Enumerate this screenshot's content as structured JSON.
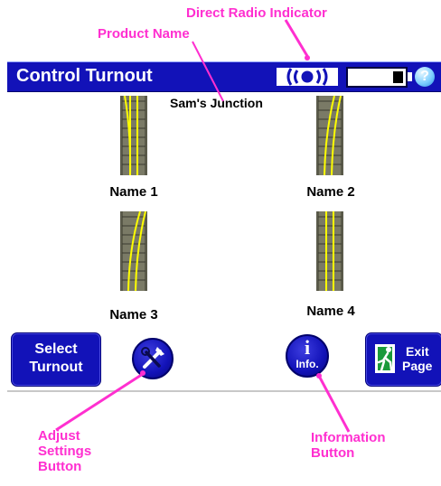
{
  "callouts": {
    "direct_radio_indicator": "Direct Radio Indicator",
    "product_name": "Product Name",
    "adjust_settings": [
      "Adjust",
      "Settings",
      "Button"
    ],
    "information": [
      "Information",
      "Button"
    ]
  },
  "header": {
    "title": "Control Turnout",
    "help_symbol": "?"
  },
  "product_name": "Sam's Junction",
  "turnouts": [
    {
      "name": "Name 1",
      "direction": "left"
    },
    {
      "name": "Name 2",
      "direction": "right"
    },
    {
      "name": "Name 3",
      "direction": "right"
    },
    {
      "name": "Name 4",
      "direction": "straight"
    }
  ],
  "buttons": {
    "select_turnout": [
      "Select",
      "Turnout"
    ],
    "info_label": "Info.",
    "exit_page": [
      "Exit",
      "Page"
    ]
  },
  "colors": {
    "accent_blue": "#1212b8",
    "callout_magenta": "#ff2fd0",
    "track_rail": "#ffff00"
  },
  "icons": {
    "radio": "radio-signal-icon",
    "battery": "battery-icon",
    "help": "help-icon",
    "settings": "tools-icon",
    "info": "info-icon",
    "exit": "exit-running-man-icon"
  }
}
